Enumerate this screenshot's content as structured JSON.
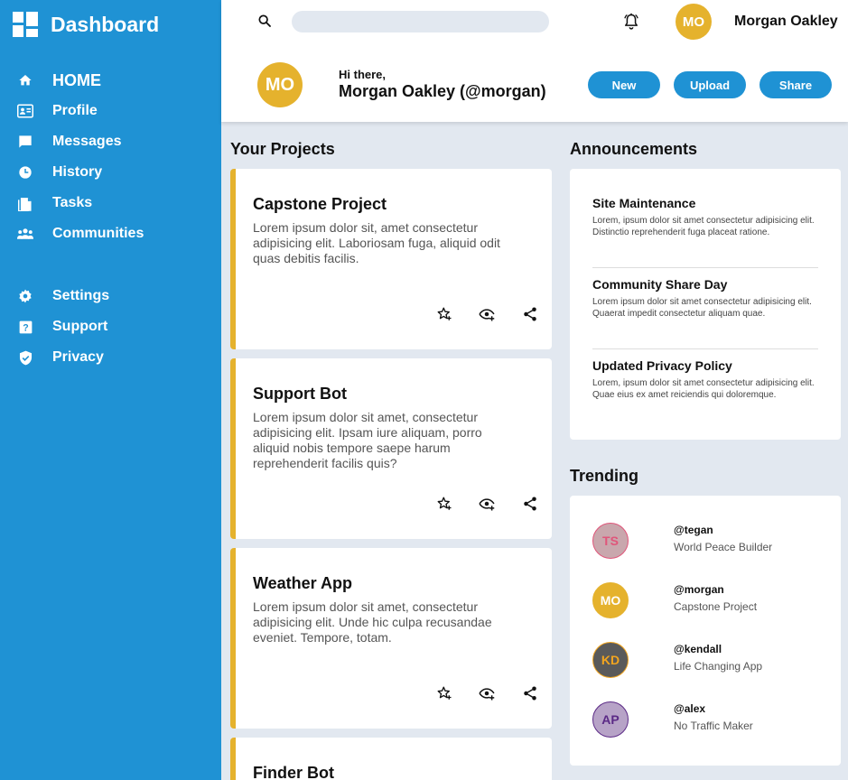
{
  "sidebar": {
    "brand": {
      "title": "Dashboard",
      "icon": "dashboard-grid-icon"
    },
    "items": [
      {
        "label": "HOME",
        "icon": "home-icon"
      },
      {
        "label": "Profile",
        "icon": "profile-card-icon"
      },
      {
        "label": "Messages",
        "icon": "message-icon"
      },
      {
        "label": "History",
        "icon": "clock-icon"
      },
      {
        "label": "Tasks",
        "icon": "document-icon"
      },
      {
        "label": "Communities",
        "icon": "people-icon"
      },
      {
        "label": "Settings",
        "icon": "gear-icon"
      },
      {
        "label": "Support",
        "icon": "help-icon"
      },
      {
        "label": "Privacy",
        "icon": "shield-icon"
      }
    ]
  },
  "header": {
    "search": {
      "placeholder": "",
      "icon": "search-icon"
    },
    "notifications_icon": "bell-icon",
    "user": {
      "initials": "MO",
      "name": "Morgan Oakley"
    },
    "greeting": {
      "small": "Hi there,",
      "big": "Morgan Oakley (@morgan)"
    },
    "buttons": {
      "new": "New",
      "upload": "Upload",
      "share": "Share"
    }
  },
  "projects": {
    "heading": "Your Projects",
    "items": [
      {
        "title": "Capstone Project",
        "desc": "Lorem ipsum dolor sit, amet consectetur adipisicing elit. Laboriosam fuga, aliquid odit quas debitis facilis."
      },
      {
        "title": "Support Bot",
        "desc": "Lorem ipsum dolor sit amet, consectetur adipisicing elit. Ipsam iure aliquam, porro aliquid nobis tempore saepe harum reprehenderit facilis quis?"
      },
      {
        "title": "Weather App",
        "desc": "Lorem ipsum dolor sit amet, consectetur adipisicing elit. Unde hic culpa recusandae eveniet. Tempore, totam."
      },
      {
        "title": "Finder Bot",
        "desc": ""
      }
    ],
    "action_icons": [
      "star-add-icon",
      "watch-icon",
      "share-icon"
    ]
  },
  "announcements": {
    "heading": "Announcements",
    "items": [
      {
        "title": "Site Maintenance",
        "body": "Lorem, ipsum dolor sit amet consectetur adipisicing elit. Distinctio reprehenderit fuga placeat ratione."
      },
      {
        "title": "Community Share Day",
        "body": "Lorem ipsum dolor sit amet consectetur adipisicing elit. Quaerat impedit consectetur aliquam quae."
      },
      {
        "title": "Updated Privacy Policy",
        "body": "Lorem, ipsum dolor sit amet consectetur adipisicing elit. Quae eius ex amet reiciendis qui doloremque."
      }
    ]
  },
  "trending": {
    "heading": "Trending",
    "items": [
      {
        "initials": "TS",
        "handle": "@tegan",
        "desc": "World Peace Builder",
        "bg": "#c9a7ad",
        "fg": "#e0557a",
        "border": "#e0557a"
      },
      {
        "initials": "MO",
        "handle": "@morgan",
        "desc": "Capstone Project",
        "bg": "#e5b22d",
        "fg": "#ffffff",
        "border": "#e5b22d"
      },
      {
        "initials": "KD",
        "handle": "@kendall",
        "desc": "Life Changing App",
        "bg": "#5a5a5a",
        "fg": "#f2a51f",
        "border": "#f2a51f"
      },
      {
        "initials": "AP",
        "handle": "@alex",
        "desc": "No Traffic Maker",
        "bg": "#b7a3c7",
        "fg": "#5b2a86",
        "border": "#5b2a86"
      }
    ]
  },
  "colors": {
    "primary": "#1f92d4",
    "accent": "#e5b22d",
    "background": "#e2e8f0",
    "card": "#ffffff"
  }
}
